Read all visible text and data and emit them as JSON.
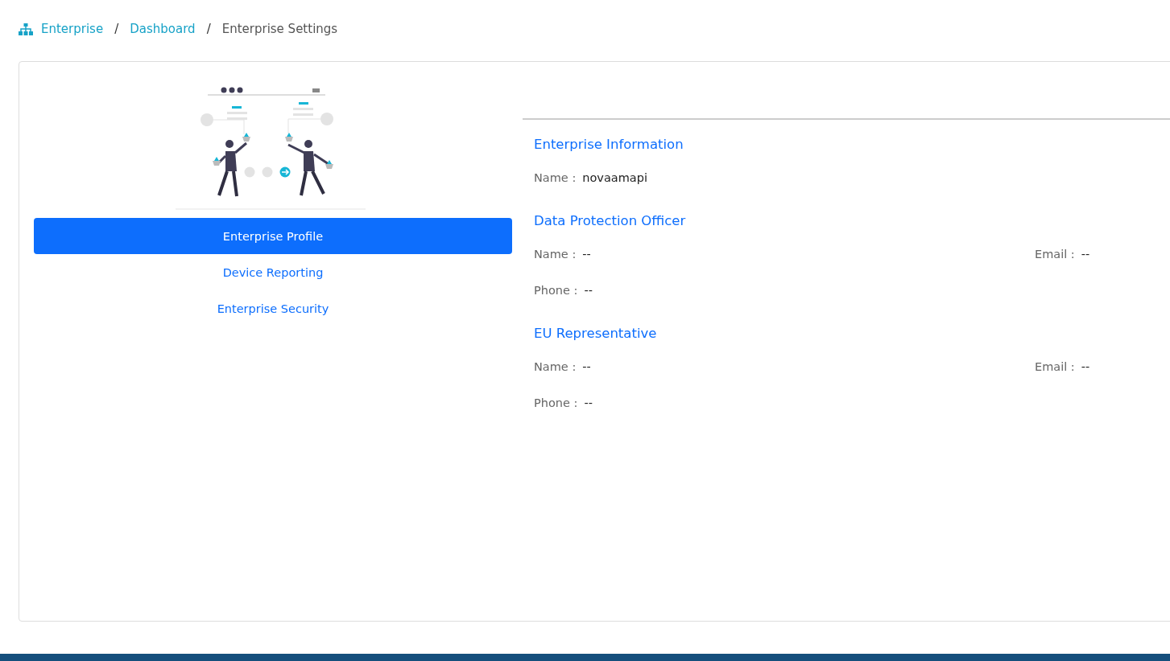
{
  "breadcrumb": [
    {
      "label": "Enterprise",
      "kind": "link"
    },
    {
      "label": "/",
      "kind": "separator"
    },
    {
      "label": "Dashboard",
      "kind": "link"
    },
    {
      "label": "/",
      "kind": "separator"
    },
    {
      "label": "Enterprise Settings",
      "kind": "current"
    }
  ],
  "menu": [
    {
      "label": "Enterprise Profile",
      "selected": true
    },
    {
      "label": "Device Reporting",
      "selected": false
    },
    {
      "label": "Enterprise Security",
      "selected": false
    }
  ],
  "sections": [
    {
      "title": "Enterprise Information",
      "rows": [
        [
          {
            "label": "Name :",
            "value": "novaamapi"
          }
        ]
      ]
    },
    {
      "title": "Data Protection Officer",
      "rows": [
        [
          {
            "label": "Name :",
            "value": "--"
          },
          {
            "label": "Email :",
            "value": "--"
          }
        ],
        [
          {
            "label": "Phone :",
            "value": "--"
          }
        ]
      ]
    },
    {
      "title": "EU Representative",
      "rows": [
        [
          {
            "label": "Name :",
            "value": "--"
          },
          {
            "label": "Email :",
            "value": "--"
          }
        ],
        [
          {
            "label": "Phone :",
            "value": "--"
          }
        ]
      ]
    }
  ]
}
